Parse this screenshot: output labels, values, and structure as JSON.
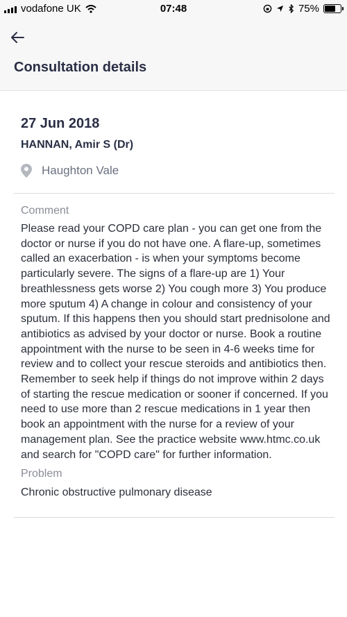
{
  "status_bar": {
    "carrier": "vodafone UK",
    "time": "07:48",
    "battery": "75%",
    "battery_level": 0.75
  },
  "header": {
    "title": "Consultation details"
  },
  "consultation": {
    "date": "27 Jun 2018",
    "clinician": "HANNAN, Amir S (Dr)",
    "location": "Haughton Vale",
    "comment_label": "Comment",
    "comment": "Please read your COPD care plan - you can get one from the doctor or nurse if you do not have one. A flare-up, sometimes called an exacerbation - is when your symptoms become particularly severe. The signs of a flare-up are 1) Your breathlessness gets worse 2) You cough more 3) You produce more sputum 4) A change in colour and consistency of your sputum. If this happens then you should start prednisolone and antibiotics as advised by your doctor or nurse. Book a routine appointment with the nurse to be seen in 4-6 weeks time for review and to collect your rescue steroids and antibiotics then. Remember to seek help if things do not improve within 2 days of starting the rescue medication or sooner if concerned. If you need to use more than 2 rescue medications in 1 year then book an appointment with the nurse for a review of your management plan. See the practice website www.htmc.co.uk and search for \"COPD care\" for further information.",
    "problem_label": "Problem",
    "problem": "Chronic obstructive pulmonary disease"
  },
  "icons": {
    "back": "back-arrow-icon",
    "location": "location-pin-icon"
  }
}
